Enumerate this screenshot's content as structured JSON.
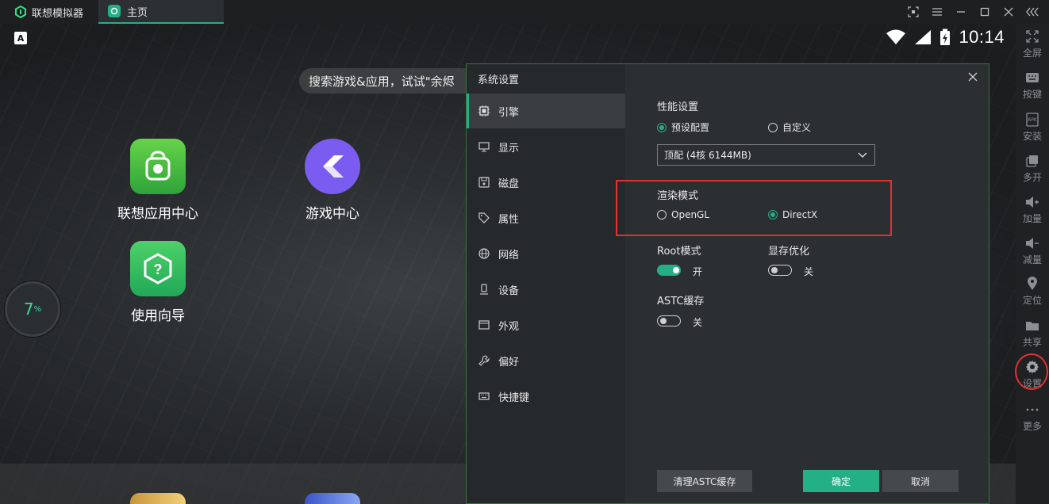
{
  "titlebar": {
    "app_name": "联想模拟器",
    "tab_label": "主页"
  },
  "android": {
    "status": {
      "time": "10:14"
    },
    "search_placeholder": "搜索游戏&应用，试试\"余烬",
    "apps": [
      {
        "label": "联想应用中心"
      },
      {
        "label": "游戏中心"
      },
      {
        "label": "使用向导"
      }
    ],
    "gauge": {
      "value": "7",
      "unit": "%"
    }
  },
  "sidebar": {
    "items": [
      {
        "label": "全屏",
        "icon": "fullscreen-icon"
      },
      {
        "label": "按键",
        "icon": "keyboard-icon"
      },
      {
        "label": "安装",
        "icon": "apk-install-icon"
      },
      {
        "label": "多开",
        "icon": "multi-instance-icon"
      },
      {
        "label": "加量",
        "icon": "volume-up-icon"
      },
      {
        "label": "减量",
        "icon": "volume-down-icon"
      },
      {
        "label": "定位",
        "icon": "location-icon"
      },
      {
        "label": "共享",
        "icon": "folder-icon"
      },
      {
        "label": "设置",
        "icon": "gear-icon"
      },
      {
        "label": "更多",
        "icon": "more-icon"
      }
    ]
  },
  "dialog": {
    "title": "系统设置",
    "nav": [
      {
        "label": "引擎",
        "icon": "engine-icon",
        "active": true
      },
      {
        "label": "显示",
        "icon": "monitor-icon"
      },
      {
        "label": "磁盘",
        "icon": "disk-icon"
      },
      {
        "label": "属性",
        "icon": "tag-icon"
      },
      {
        "label": "网络",
        "icon": "globe-icon"
      },
      {
        "label": "设备",
        "icon": "device-icon"
      },
      {
        "label": "外观",
        "icon": "appearance-icon"
      },
      {
        "label": "偏好",
        "icon": "wrench-icon"
      },
      {
        "label": "快捷键",
        "icon": "keyboard-icon"
      }
    ],
    "performance": {
      "label": "性能设置",
      "options": [
        "预设配置",
        "自定义"
      ],
      "selected": "预设配置",
      "preset_value": "顶配 (4核 6144MB)"
    },
    "render": {
      "label": "渲染模式",
      "options": [
        "OpenGL",
        "DirectX"
      ],
      "selected": "DirectX"
    },
    "root": {
      "label": "Root模式",
      "state": "开",
      "on": true
    },
    "vram": {
      "label": "显存优化",
      "state": "关",
      "on": false
    },
    "astc": {
      "label": "ASTC缓存",
      "state": "关",
      "on": false
    },
    "buttons": {
      "clear_astc": "清理ASTC缓存",
      "ok": "确定",
      "cancel": "取消"
    }
  },
  "colors": {
    "accent": "#22b084",
    "highlight": "#e03232"
  }
}
